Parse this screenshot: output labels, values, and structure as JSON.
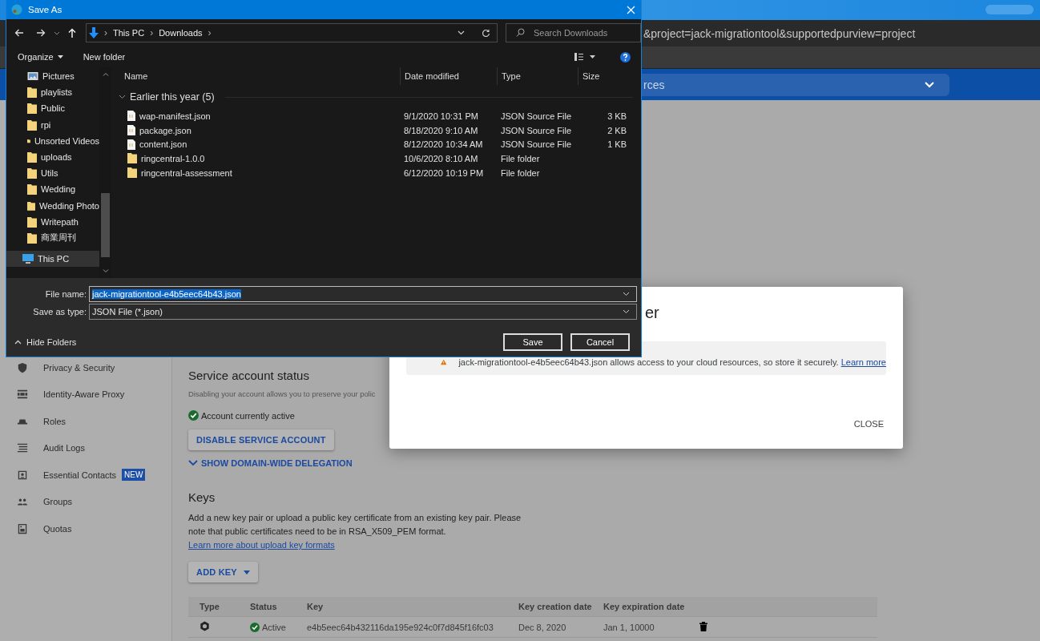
{
  "browser": {
    "url": "&project=jack-migrationtool&supportedpurview=project",
    "search_field": "rces"
  },
  "sidebar": {
    "items": [
      {
        "label": "Privacy & Security"
      },
      {
        "label": "Identity-Aware Proxy"
      },
      {
        "label": "Roles"
      },
      {
        "label": "Audit Logs"
      },
      {
        "label": "Essential Contacts",
        "badge": "NEW"
      },
      {
        "label": "Groups"
      },
      {
        "label": "Quotas"
      }
    ]
  },
  "service_account_status": {
    "heading": "Service account status",
    "description": "Disabling your account allows you to preserve your polic",
    "status": "Account currently active",
    "disable_button": "DISABLE SERVICE ACCOUNT",
    "delegation_link": "SHOW DOMAIN-WIDE DELEGATION"
  },
  "keys": {
    "heading": "Keys",
    "description": "Add a new key pair or upload a public key certificate from an existing key pair. Please note that public certificates need to be in RSA_X509_PEM format.",
    "link": "Learn more about upload key formats",
    "add_button": "ADD KEY",
    "table": {
      "columns": [
        "Type",
        "Status",
        "Key",
        "Key creation date",
        "Key expiration date"
      ],
      "rows": [
        {
          "status": "Active",
          "key": "e4b5eec64b432116da195e924c0f7d845f16fc03",
          "created": "Dec 8, 2020",
          "expires": "Jan 1, 10000"
        }
      ]
    }
  },
  "modal": {
    "title": "er",
    "warning": "jack-migrationtool-e4b5eec64b43.json allows access to your cloud resources, so store it securely.",
    "link": "Learn more",
    "close_button": "CLOSE"
  },
  "save_dialog": {
    "title": "Save As",
    "path": [
      "This PC",
      "Downloads"
    ],
    "path_separator": "›",
    "search_placeholder": "Search Downloads",
    "organize": "Organize",
    "new_folder": "New folder",
    "nav_items": [
      {
        "label": "Pictures",
        "kind": "pictures",
        "selected": false
      },
      {
        "label": "playlists",
        "kind": "folder",
        "selected": false
      },
      {
        "label": "Public",
        "kind": "folder",
        "selected": false
      },
      {
        "label": "rpi",
        "kind": "folder",
        "selected": false
      },
      {
        "label": "Unsorted Videos",
        "kind": "folder",
        "selected": false
      },
      {
        "label": "uploads",
        "kind": "folder",
        "selected": false
      },
      {
        "label": "Utils",
        "kind": "folder",
        "selected": false
      },
      {
        "label": "Wedding",
        "kind": "folder",
        "selected": false
      },
      {
        "label": "Wedding Photo",
        "kind": "folder",
        "selected": false
      },
      {
        "label": "Writepath",
        "kind": "folder",
        "selected": false
      },
      {
        "label": "商業周刊",
        "kind": "folder",
        "selected": false
      },
      {
        "label": "This PC",
        "kind": "pc",
        "selected": true
      }
    ],
    "columns": [
      "Name",
      "Date modified",
      "Type",
      "Size"
    ],
    "group": {
      "label": "Earlier this year (5)",
      "expanded": true
    },
    "files": [
      {
        "name": "wap-manifest.json",
        "kind": "json",
        "date": "9/1/2020 10:31 PM",
        "type": "JSON Source File",
        "size": "3 KB"
      },
      {
        "name": "package.json",
        "kind": "json",
        "date": "8/18/2020 9:10 AM",
        "type": "JSON Source File",
        "size": "2 KB"
      },
      {
        "name": "content.json",
        "kind": "json",
        "date": "8/12/2020 10:34 AM",
        "type": "JSON Source File",
        "size": "1 KB"
      },
      {
        "name": "ringcentral-1.0.0",
        "kind": "folder",
        "date": "10/6/2020 8:10 AM",
        "type": "File folder"
      },
      {
        "name": "ringcentral-assessment",
        "kind": "folder",
        "date": "6/12/2020 10:19 PM",
        "type": "File folder"
      }
    ],
    "file_name_label": "File name:",
    "file_name": "jack-migrationtool-e4b5eec64b43.json",
    "file_name_selected": true,
    "type_label": "Save as type:",
    "type_value": "JSON File (*.json)",
    "hide_folders": "Hide Folders",
    "save_button": "Save",
    "cancel_button": "Cancel"
  }
}
